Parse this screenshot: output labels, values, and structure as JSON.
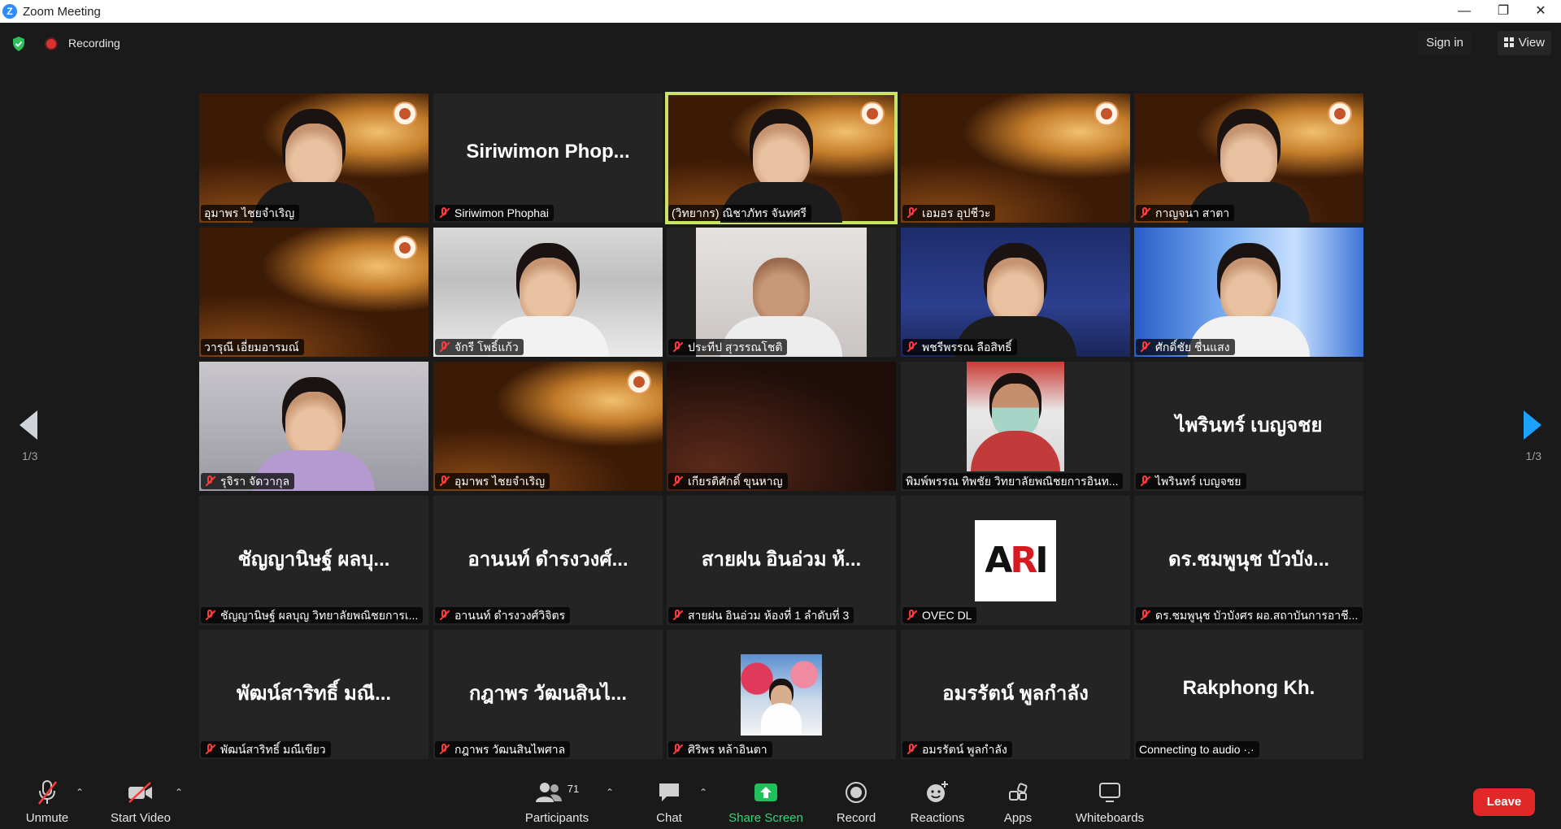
{
  "window": {
    "title": "Zoom Meeting",
    "logo_letter": "Z"
  },
  "topbar": {
    "recording_label": "Recording",
    "signin_label": "Sign in",
    "view_label": "View"
  },
  "pagination": {
    "left_indicator": "1/3",
    "right_indicator": "1/3"
  },
  "tiles": [
    {
      "label": "อุมาพร ไชยจำเริญ",
      "big": "",
      "muted": false,
      "style": "gold-person"
    },
    {
      "label": "Siriwimon Phophai",
      "big": "Siriwimon  Phop...",
      "muted": true,
      "style": "name"
    },
    {
      "label": "(วิทยากร) ณิชาภัทร จันทศรี",
      "big": "",
      "muted": false,
      "style": "gold-person",
      "active": true
    },
    {
      "label": "เอมอร อุปชีวะ",
      "big": "",
      "muted": true,
      "style": "gold"
    },
    {
      "label": "กาญจนา สาตา",
      "big": "",
      "muted": true,
      "style": "gold-person"
    },
    {
      "label": "วารุณี เอี่ยมอารมณ์",
      "big": "",
      "muted": false,
      "style": "gold"
    },
    {
      "label": "จักรี โพธิ์แก้ว",
      "big": "",
      "muted": true,
      "style": "office"
    },
    {
      "label": "ประทีป สุวรรณโชติ",
      "big": "",
      "muted": true,
      "style": "pale"
    },
    {
      "label": "พชรีพรรณ ลือสิทธิ์",
      "big": "",
      "muted": true,
      "style": "banner"
    },
    {
      "label": "ศักดิ์ชัย ชื่นแสง",
      "big": "",
      "muted": true,
      "style": "blue"
    },
    {
      "label": "รุจิรา จัดวากุล",
      "big": "",
      "muted": true,
      "style": "pale-person"
    },
    {
      "label": "อุมาพร ไชยจำเริญ",
      "big": "",
      "muted": true,
      "style": "gold"
    },
    {
      "label": "เกียรติศักดิ์ ขุนหาญ",
      "big": "",
      "muted": true,
      "style": "darkred"
    },
    {
      "label": "พิมพ์พรรณ ทิพชัย วิทยาลัยพณิชยการอินท...",
      "big": "",
      "muted": false,
      "style": "store"
    },
    {
      "label": "ไพรินทร์ เบญจชย",
      "big": "ไพรินทร์ เบญจชย",
      "muted": true,
      "style": "name"
    },
    {
      "label": "ชัญญานิษฐ์ ผลบุญ วิทยาลัยพณิชยการเ...",
      "big": "ชัญญานิษฐ์ ผลบุ...",
      "muted": true,
      "style": "name"
    },
    {
      "label": "อานนท์ ดำรงวงศ์วิจิตร",
      "big": "อานนท์  ดำรงวงศ์...",
      "muted": true,
      "style": "name"
    },
    {
      "label": "สายฝน อินอ่วม ห้องที่ 1 ลำดับที่ 3",
      "big": "สายฝน อินอ่วม ห้...",
      "muted": true,
      "style": "name"
    },
    {
      "label": "OVEC DL",
      "big": "",
      "muted": true,
      "style": "ari"
    },
    {
      "label": "ดร.ชมพูนุช บัวบังศร ผอ.สถาบันการอาชี...",
      "big": "ดร.ชมพูนุช บัวบัง...",
      "muted": true,
      "style": "name"
    },
    {
      "label": "พัฒน์สาริทธิ์ มณีเขียว",
      "big": "พัฒน์สาริทธิ์ มณี...",
      "muted": true,
      "style": "name"
    },
    {
      "label": "กฎาพร วัฒนสินไพศาล",
      "big": "กฎาพร วัฒนสินไ...",
      "muted": true,
      "style": "name"
    },
    {
      "label": "ศิริพร หล้าอินตา",
      "big": "",
      "muted": true,
      "style": "photo"
    },
    {
      "label": "อมรรัตน์ พูลกำลัง",
      "big": "อมรรัตน์ พูลกำลัง",
      "muted": true,
      "style": "name"
    },
    {
      "label": "Connecting to audio ·.·",
      "big": "Rakphong Kh.",
      "muted": false,
      "style": "name"
    }
  ],
  "ari_logo": {
    "text_a": "A",
    "text_r": "R",
    "text_i": "I"
  },
  "toolbar": {
    "unmute": "Unmute",
    "start_video": "Start Video",
    "participants": "Participants",
    "participants_count": "71",
    "chat": "Chat",
    "share_screen": "Share Screen",
    "record": "Record",
    "reactions": "Reactions",
    "apps": "Apps",
    "whiteboards": "Whiteboards",
    "leave": "Leave"
  },
  "colors": {
    "accent_active": "#c9e36a",
    "leave": "#e02828",
    "share": "#37d67a",
    "muted_red": "#ff3b3b",
    "nav_right": "#1da1ff"
  }
}
